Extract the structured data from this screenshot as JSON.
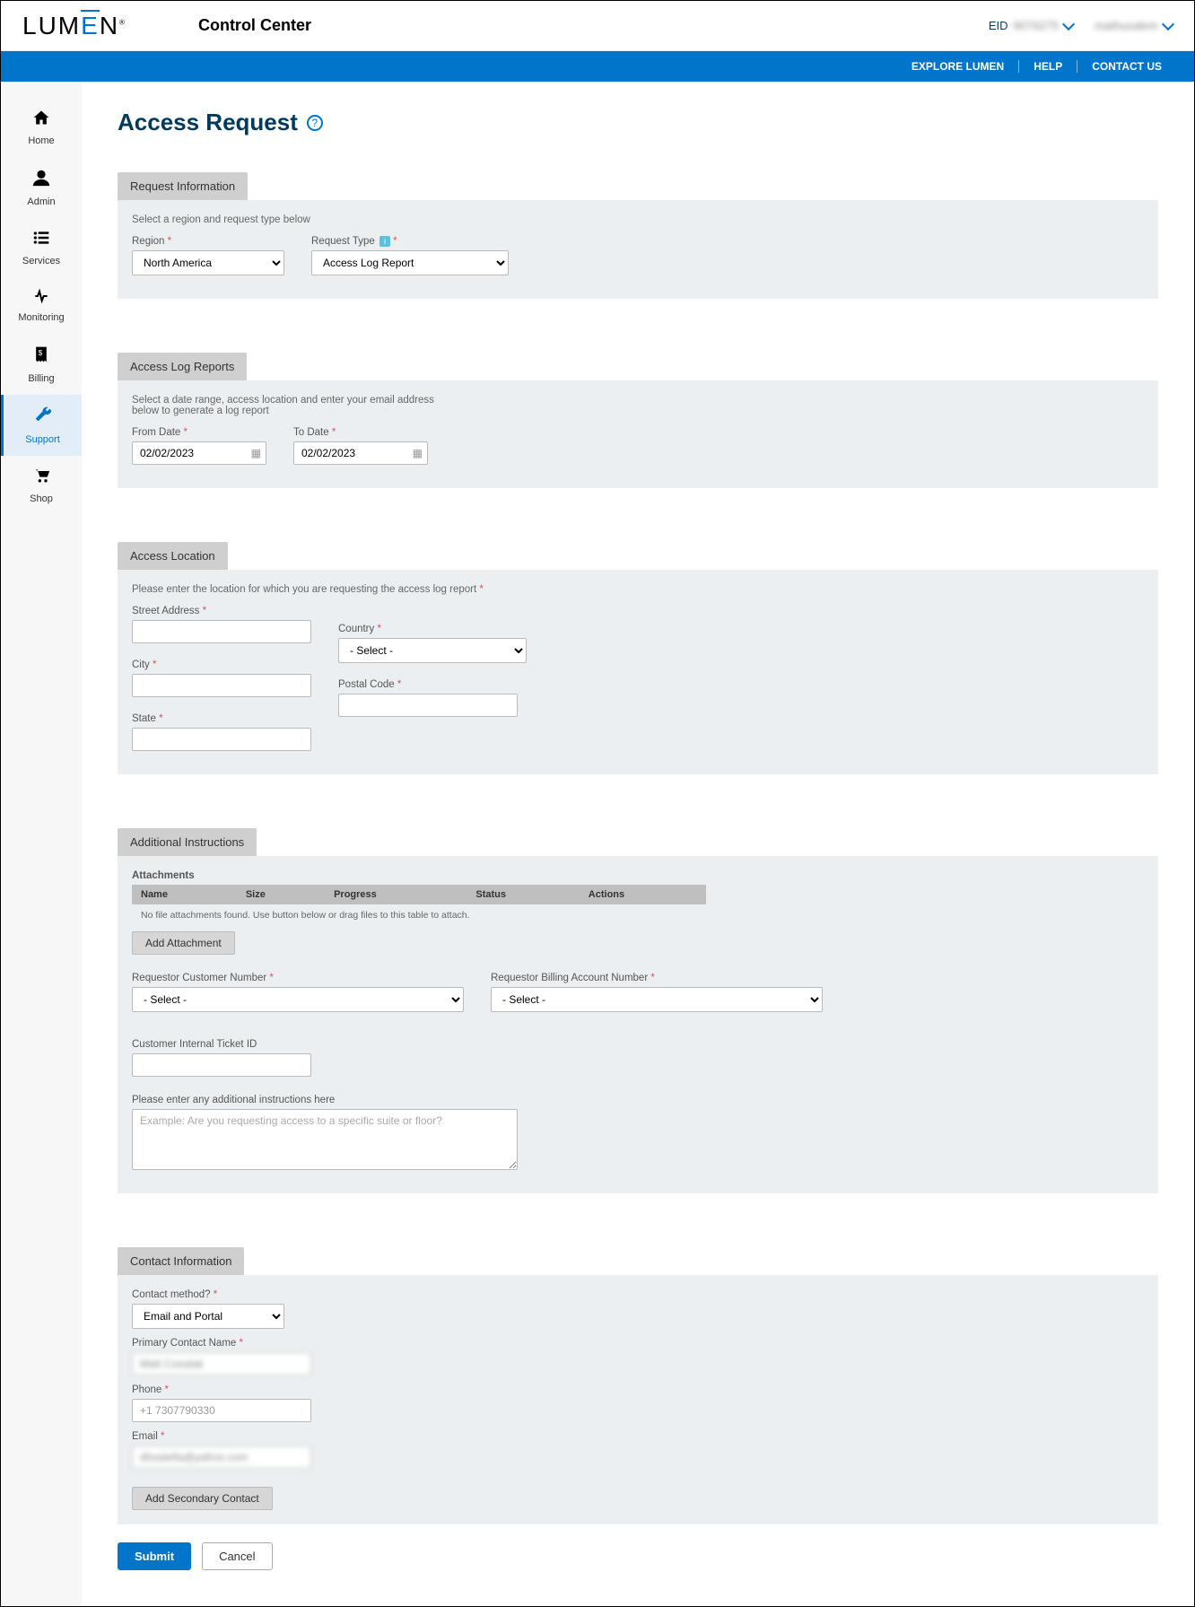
{
  "header": {
    "logo_text": "LUMEN",
    "app_title": "Control Center",
    "eid_label": "EID",
    "eid_value": "9076275",
    "user_name": "mathusalem"
  },
  "bluebar": {
    "explore": "EXPLORE LUMEN",
    "help": "HELP",
    "contact": "CONTACT US"
  },
  "sidebar": {
    "items": [
      {
        "label": "Home",
        "icon": "home"
      },
      {
        "label": "Admin",
        "icon": "user"
      },
      {
        "label": "Services",
        "icon": "list"
      },
      {
        "label": "Monitoring",
        "icon": "pulse"
      },
      {
        "label": "Billing",
        "icon": "invoice"
      },
      {
        "label": "Support",
        "icon": "wrench"
      },
      {
        "label": "Shop",
        "icon": "cart"
      }
    ],
    "active_index": 5
  },
  "page": {
    "title": "Access Request"
  },
  "sections": {
    "request_info": {
      "title": "Request Information",
      "desc": "Select a region and request type below",
      "region_label": "Region",
      "region_value": "North America",
      "request_type_label": "Request Type",
      "request_type_value": "Access Log Report"
    },
    "access_log": {
      "title": "Access Log Reports",
      "desc": "Select a date range, access location and enter your email address below to generate a log report",
      "from_label": "From Date",
      "from_value": "02/02/2023",
      "to_label": "To Date",
      "to_value": "02/02/2023"
    },
    "location": {
      "title": "Access Location",
      "desc": "Please enter the location for which you are requesting the access log report",
      "street_label": "Street Address",
      "street_value": "",
      "city_label": "City",
      "city_value": "",
      "state_label": "State",
      "state_value": "",
      "country_label": "Country",
      "country_value": "- Select -",
      "postal_label": "Postal Code",
      "postal_value": ""
    },
    "additional": {
      "title": "Additional Instructions",
      "attachments_label": "Attachments",
      "cols": {
        "name": "Name",
        "size": "Size",
        "progress": "Progress",
        "status": "Status",
        "actions": "Actions"
      },
      "empty_msg": "No file attachments found. Use button below or drag files to this table to attach.",
      "add_attach_btn": "Add Attachment",
      "cust_num_label": "Requestor Customer Number",
      "cust_num_value": "- Select -",
      "billing_label": "Requestor Billing Account Number",
      "billing_value": "- Select -",
      "ticket_label": "Customer Internal Ticket ID",
      "ticket_value": "",
      "instructions_label": "Please enter any additional instructions here",
      "instructions_placeholder": "Example: Are you requesting access to a specific suite or floor?",
      "instructions_value": ""
    },
    "contact": {
      "title": "Contact Information",
      "method_label": "Contact method?",
      "method_value": "Email and Portal",
      "name_label": "Primary Contact Name",
      "name_value": "Matt Coxatak",
      "phone_label": "Phone",
      "phone_value": "+1 7307790330",
      "email_label": "Email",
      "email_value": "dhoalefia@yafroo.com",
      "add_secondary_btn": "Add Secondary Contact"
    }
  },
  "buttons": {
    "submit": "Submit",
    "cancel": "Cancel"
  }
}
